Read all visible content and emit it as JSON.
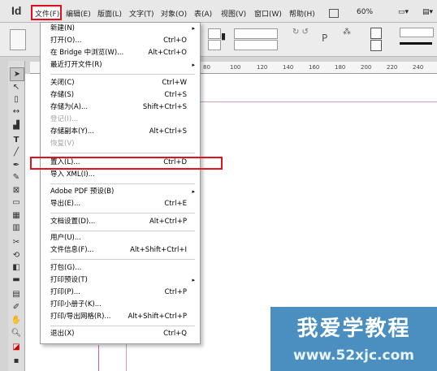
{
  "app": {
    "logo": "Id",
    "zoom": "60%"
  },
  "menubar": [
    {
      "label": "文件(F)"
    },
    {
      "label": "编辑(E)"
    },
    {
      "label": "版面(L)"
    },
    {
      "label": "文字(T)"
    },
    {
      "label": "对象(O)"
    },
    {
      "label": "表(A)"
    },
    {
      "label": "视图(V)"
    },
    {
      "label": "窗口(W)"
    },
    {
      "label": "帮助(H)"
    }
  ],
  "ruler": [
    "80",
    "100",
    "120",
    "140",
    "160",
    "180",
    "200",
    "220",
    "240"
  ],
  "file_menu": [
    {
      "label": "新建(N)",
      "shortcut": "",
      "submenu": true
    },
    {
      "label": "打开(O)...",
      "shortcut": "Ctrl+O"
    },
    {
      "label": "在 Bridge 中浏览(W)...",
      "shortcut": "Alt+Ctrl+O"
    },
    {
      "label": "最近打开文件(R)",
      "shortcut": "",
      "submenu": true
    },
    {
      "sep": true
    },
    {
      "label": "关闭(C)",
      "shortcut": "Ctrl+W"
    },
    {
      "label": "存储(S)",
      "shortcut": "Ctrl+S"
    },
    {
      "label": "存储为(A)...",
      "shortcut": "Shift+Ctrl+S"
    },
    {
      "label": "登记(I)...",
      "shortcut": "",
      "disabled": true
    },
    {
      "label": "存储副本(Y)...",
      "shortcut": "Alt+Ctrl+S"
    },
    {
      "label": "恢复(V)",
      "shortcut": "",
      "disabled": true
    },
    {
      "sep": true
    },
    {
      "label": "置入(L)...",
      "shortcut": "Ctrl+D",
      "highlighted": true
    },
    {
      "label": "导入 XML(I)...",
      "shortcut": ""
    },
    {
      "sep": true
    },
    {
      "label": "Adobe PDF 预设(B)",
      "shortcut": "",
      "submenu": true
    },
    {
      "label": "导出(E)...",
      "shortcut": "Ctrl+E"
    },
    {
      "sep": true
    },
    {
      "label": "文档设置(D)...",
      "shortcut": "Alt+Ctrl+P"
    },
    {
      "sep": true
    },
    {
      "label": "用户(U)...",
      "shortcut": ""
    },
    {
      "label": "文件信息(F)...",
      "shortcut": "Alt+Shift+Ctrl+I"
    },
    {
      "sep": true
    },
    {
      "label": "打包(G)...",
      "shortcut": ""
    },
    {
      "label": "打印预设(T)",
      "shortcut": "",
      "submenu": true
    },
    {
      "label": "打印(P)...",
      "shortcut": "Ctrl+P"
    },
    {
      "label": "打印小册子(K)...",
      "shortcut": ""
    },
    {
      "label": "打印/导出网格(R)...",
      "shortcut": "Alt+Shift+Ctrl+P"
    },
    {
      "sep": true
    },
    {
      "label": "退出(X)",
      "shortcut": "Ctrl+Q"
    }
  ],
  "watermark": {
    "title": "我爱学教程",
    "url": "www.52xjc.com"
  },
  "colors": {
    "highlight_box": "#e0121d",
    "watermark_bg": "#4a8fbf"
  }
}
